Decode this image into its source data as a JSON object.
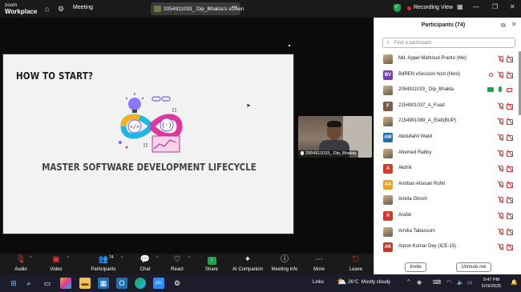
{
  "app": {
    "logo_line1": "zoom",
    "logo_line2": "Workplace"
  },
  "titlebar": {
    "meeting_label": "Meeting",
    "share_label": "2054911033_ Dip_Bhakta's screen",
    "recording_label": "Recording",
    "view_label": "View"
  },
  "slide": {
    "heading": "HOW TO START?",
    "title": "MASTER SOFTWARE DEVELOPMENT LIFECYCLE"
  },
  "video_tile": {
    "name": "2054911033_ Dip_Bhakta"
  },
  "panel": {
    "title": "Participants (74)",
    "search_placeholder": "Find a participant",
    "participants": [
      {
        "name": "Md. Appel Mahmud Pranto (Me)",
        "initials": "",
        "avatar_color": "",
        "photo": true
      },
      {
        "name": "BdREN vSession host (Host)",
        "initials": "BV",
        "avatar_color": "#7b3fb5",
        "photo": false
      },
      {
        "name": "2054911033_ Dip_Bhakta",
        "initials": "",
        "avatar_color": "",
        "photo": true
      },
      {
        "name": "2154901037_A_Fuad",
        "initials": "F",
        "avatar_color": "#7a5a48",
        "photo": false
      },
      {
        "name": "2154901089_A_Elafi(BUP)",
        "initials": "",
        "avatar_color": "",
        "photo": true
      },
      {
        "name": "Abdullahil Wakil",
        "initials": "AW",
        "avatar_color": "#1f6fb5",
        "photo": false
      },
      {
        "name": "Ahemed Rabby",
        "initials": "",
        "avatar_color": "",
        "photo": true
      },
      {
        "name": "Akdrik",
        "initials": "A",
        "avatar_color": "#d33a2c",
        "photo": false
      },
      {
        "name": "Anirban Ahasan Rohit",
        "initials": "AA",
        "avatar_color": "#f0a020",
        "photo": false
      },
      {
        "name": "Ankita Ghosh",
        "initials": "",
        "avatar_color": "",
        "photo": true
      },
      {
        "name": "Arafat",
        "initials": "A",
        "avatar_color": "#d33a2c",
        "photo": false
      },
      {
        "name": "Arnika Tabassum",
        "initials": "",
        "avatar_color": "",
        "photo": true
      },
      {
        "name": "Arpon Kumar Dey (ICE-15)",
        "initials": "AK",
        "avatar_color": "#c0392b",
        "photo": false
      }
    ],
    "invite_label": "Invite",
    "unmute_label": "Unmute me"
  },
  "toolbar": {
    "audio": "Audio",
    "video": "Video",
    "participants": "Participants",
    "participants_count": "74",
    "chat": "Chat",
    "react": "React",
    "share": "Share",
    "ai_companion": "AI Companion",
    "meeting_info": "Meeting info",
    "more": "More",
    "leave": "Leave"
  },
  "taskbar": {
    "links": "Links",
    "temperature": "26°C",
    "weather": "Mostly cloudy",
    "time": "9:47 PM",
    "date": "5/19/2025"
  }
}
